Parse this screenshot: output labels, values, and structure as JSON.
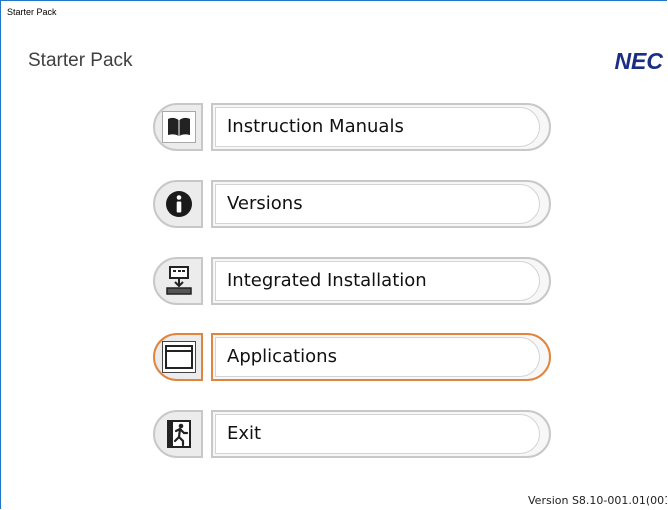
{
  "window": {
    "title": "Starter Pack"
  },
  "header": {
    "app_name": "Starter Pack",
    "logo_text": "NEC"
  },
  "menu": {
    "selected_item": "Applications",
    "items": [
      {
        "label": "Instruction Manuals",
        "icon": "book-icon"
      },
      {
        "label": "Versions",
        "icon": "info-icon"
      },
      {
        "label": "Integrated Installation",
        "icon": "install-icon"
      },
      {
        "label": "Applications",
        "icon": "window-icon"
      },
      {
        "label": "Exit",
        "icon": "exit-icon"
      }
    ]
  },
  "footer": {
    "version": "Version S8.10-001.01(001"
  },
  "colors": {
    "selected_border": "#e0843e",
    "logo": "#1b2e86",
    "window_border": "#1f77c9"
  }
}
